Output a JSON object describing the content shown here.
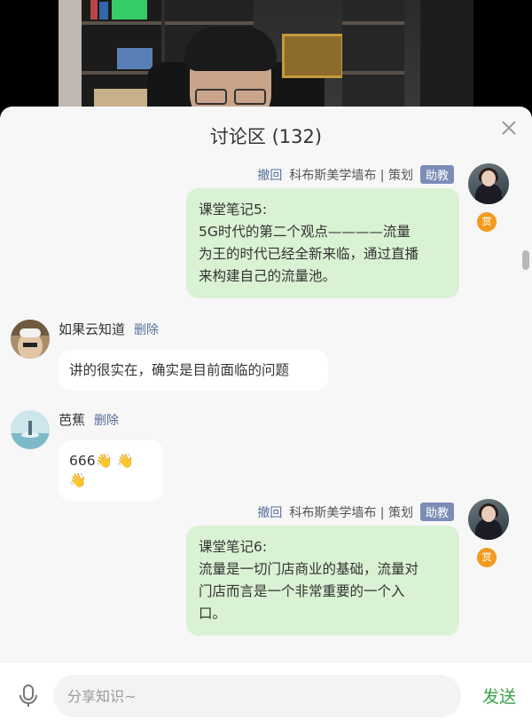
{
  "panel": {
    "title": "讨论区 (132)"
  },
  "messages": [
    {
      "side": "right",
      "undo": "撤回",
      "author": "科布斯美学墙布 | 策划",
      "badge": "助教",
      "reward": "赏",
      "lines": [
        "课堂笔记5:",
        "5G时代的第二个观点————流量",
        "为王的时代已经全新来临，通过直播",
        "来构建自己的流量池。"
      ]
    },
    {
      "side": "left",
      "author": "如果云知道",
      "delete": "删除",
      "text": "讲的很实在，确实是目前面临的问题"
    },
    {
      "side": "left",
      "author": "芭蕉",
      "delete": "删除",
      "text": "666👋 👋 👋"
    },
    {
      "side": "right",
      "undo": "撤回",
      "author": "科布斯美学墙布 | 策划",
      "badge": "助教",
      "reward": "赏",
      "lines": [
        "课堂笔记6:",
        "流量是一切门店商业的基础，流量对",
        "门店而言是一个非常重要的一个入",
        "口。"
      ]
    }
  ],
  "composer": {
    "placeholder": "分享知识~",
    "send": "发送",
    "mic_icon": "microphone-icon"
  },
  "colors": {
    "accent_green": "#3aa34a",
    "bubble_green": "#d9f2d3",
    "link_blue": "#556f9a",
    "badge_blue": "#7b8db7",
    "reward_orange": "#f39a1e"
  }
}
